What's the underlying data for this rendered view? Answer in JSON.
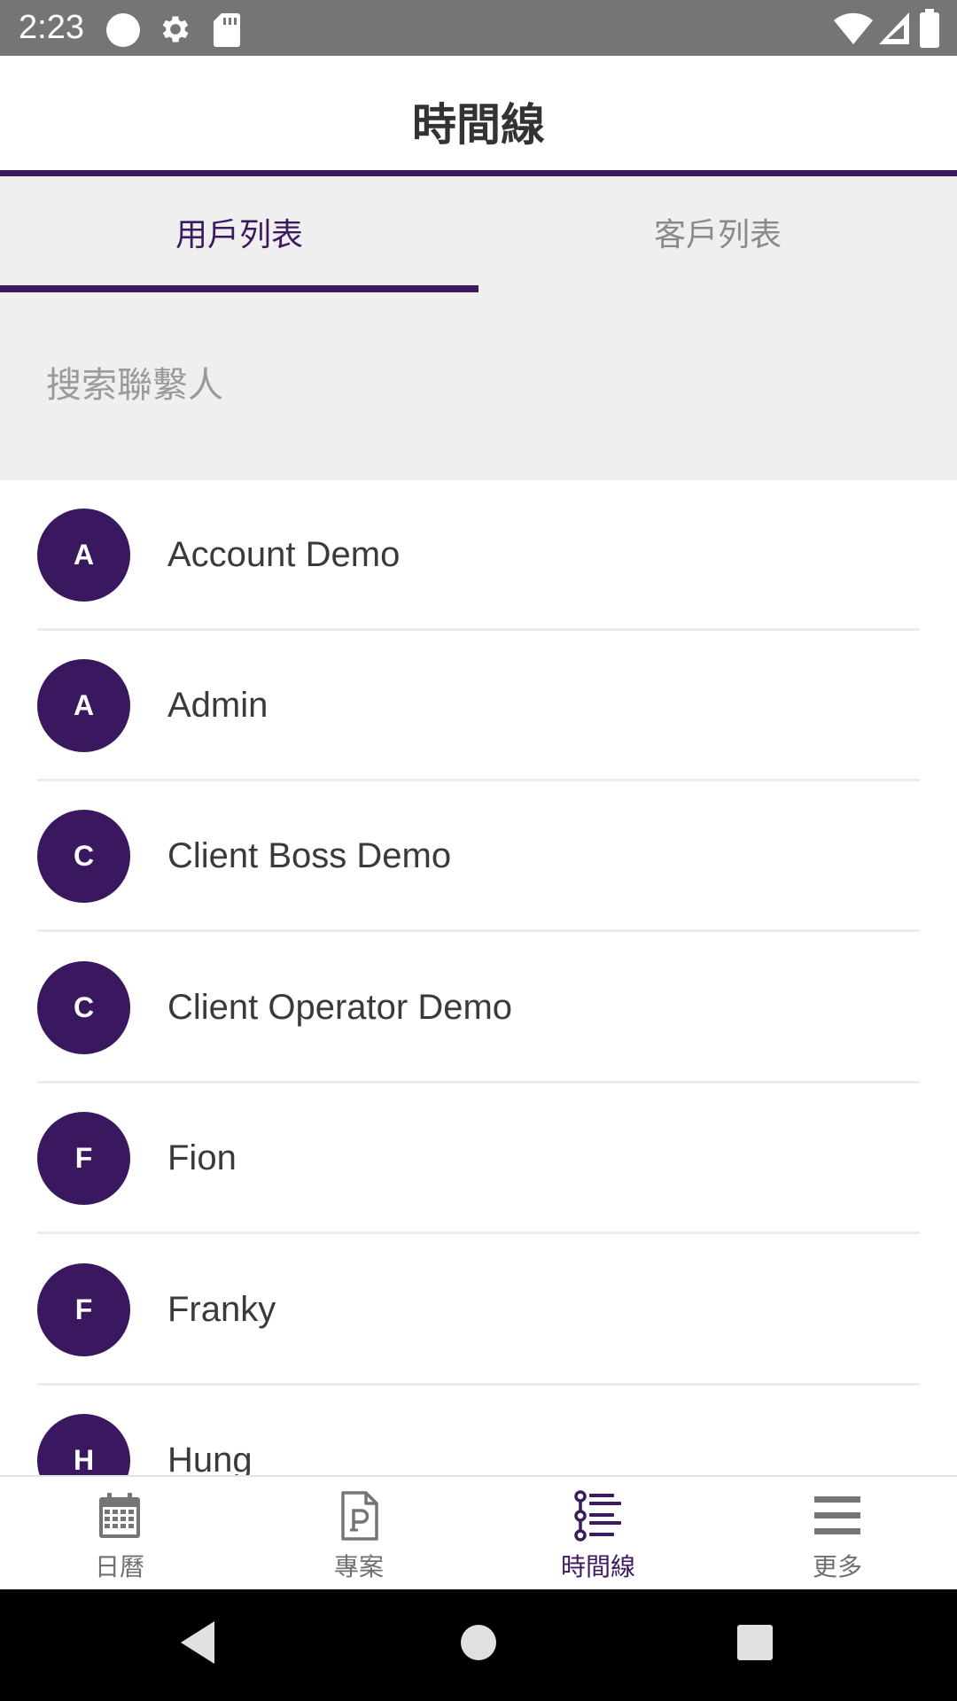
{
  "status_bar": {
    "time": "2:23",
    "left_icons": [
      "circle-icon",
      "settings-icon",
      "sd-card-icon"
    ],
    "right_icons": [
      "wifi-icon",
      "signal-icon",
      "battery-icon"
    ]
  },
  "app_bar": {
    "title": "時間線"
  },
  "tabs": [
    {
      "label": "用戶列表",
      "selected": true
    },
    {
      "label": "客戶列表",
      "selected": false
    }
  ],
  "search": {
    "placeholder": "搜索聯繫人",
    "value": ""
  },
  "contacts": [
    {
      "initial": "A",
      "name": "Account Demo"
    },
    {
      "initial": "A",
      "name": "Admin"
    },
    {
      "initial": "C",
      "name": "Client Boss Demo"
    },
    {
      "initial": "C",
      "name": "Client Operator Demo"
    },
    {
      "initial": "F",
      "name": "Fion"
    },
    {
      "initial": "F",
      "name": "Franky"
    },
    {
      "initial": "H",
      "name": "Hung"
    }
  ],
  "bottom_nav": [
    {
      "label": "日曆",
      "icon": "calendar-icon",
      "active": false
    },
    {
      "label": "專案",
      "icon": "project-icon",
      "active": false
    },
    {
      "label": "時間線",
      "icon": "timeline-icon",
      "active": true
    },
    {
      "label": "更多",
      "icon": "menu-icon",
      "active": false
    }
  ],
  "colors": {
    "accent": "#3d1a5e",
    "avatar": "#3a1860",
    "status_bar": "#757575",
    "tab_background": "#efefef",
    "inactive_text": "#8a8a8a"
  }
}
